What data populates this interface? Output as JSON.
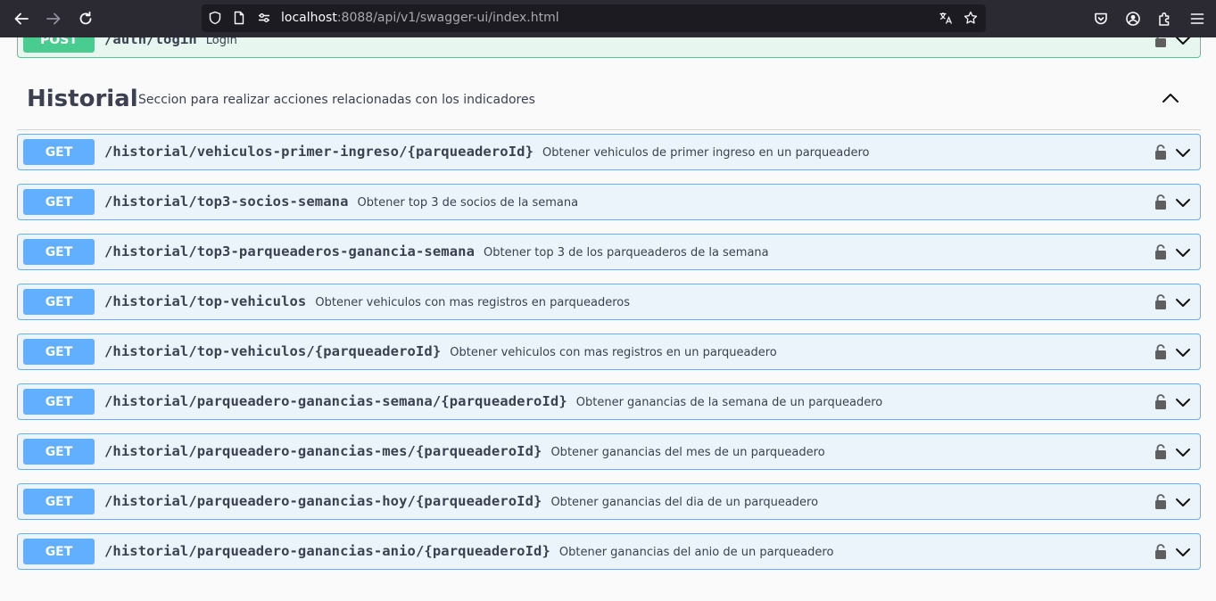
{
  "browser": {
    "url_host": "localhost",
    "url_rest": ":8088/api/v1/swagger-ui/index.html"
  },
  "auth_block": {
    "method": "POST",
    "path": "/auth/login",
    "summary": "Login"
  },
  "tag": {
    "title": "Historial",
    "description": "Seccion para realizar acciones relacionadas con los indicadores"
  },
  "endpoints": [
    {
      "method": "GET",
      "path": "/historial/vehiculos-primer-ingreso/{parqueaderoId}",
      "summary": "Obtener vehiculos de primer ingreso en un parqueadero"
    },
    {
      "method": "GET",
      "path": "/historial/top3-socios-semana",
      "summary": "Obtener top 3 de socios de la semana"
    },
    {
      "method": "GET",
      "path": "/historial/top3-parqueaderos-ganancia-semana",
      "summary": "Obtener top 3 de los parqueaderos de la semana"
    },
    {
      "method": "GET",
      "path": "/historial/top-vehiculos",
      "summary": "Obtener vehiculos con mas registros en parqueaderos"
    },
    {
      "method": "GET",
      "path": "/historial/top-vehiculos/{parqueaderoId}",
      "summary": "Obtener vehiculos con mas registros en un parqueadero"
    },
    {
      "method": "GET",
      "path": "/historial/parqueadero-ganancias-semana/{parqueaderoId}",
      "summary": "Obtener ganancias de la semana de un parqueadero"
    },
    {
      "method": "GET",
      "path": "/historial/parqueadero-ganancias-mes/{parqueaderoId}",
      "summary": "Obtener ganancias del mes de un parqueadero"
    },
    {
      "method": "GET",
      "path": "/historial/parqueadero-ganancias-hoy/{parqueaderoId}",
      "summary": "Obtener ganancias del dia de un parqueadero"
    },
    {
      "method": "GET",
      "path": "/historial/parqueadero-ganancias-anio/{parqueaderoId}",
      "summary": "Obtener ganancias del anio de un parqueadero"
    }
  ],
  "colors": {
    "get": "#61affe",
    "post": "#49cc90",
    "text": "#3b4151"
  }
}
